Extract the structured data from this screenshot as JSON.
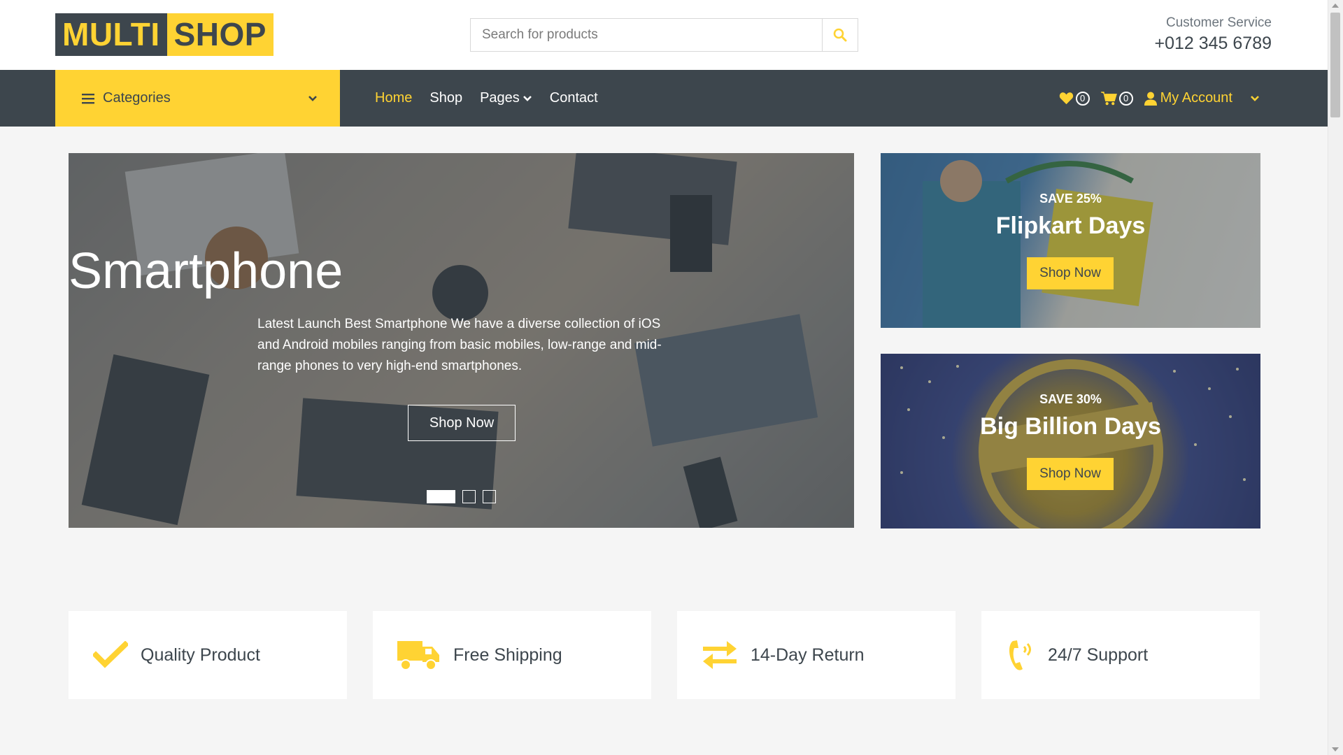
{
  "header": {
    "logo_part1": "MULTI",
    "logo_part2": "SHOP",
    "search_placeholder": "Search for products",
    "customer_service_label": "Customer Service",
    "customer_service_phone": "+012 345 6789"
  },
  "nav": {
    "categories_label": "Categories",
    "menu": [
      {
        "label": "Home",
        "active": true
      },
      {
        "label": "Shop"
      },
      {
        "label": "Pages",
        "has_dropdown": true
      },
      {
        "label": "Contact"
      }
    ],
    "wishlist_count": "0",
    "cart_count": "0",
    "account_label": "My Account"
  },
  "hero": {
    "title": "Smartphone",
    "description": "Latest Launch Best Smartphone We have a diverse collection of iOS and Android mobiles ranging from basic mobiles, low-range and mid-range phones to very high-end smartphones.",
    "button_label": "Shop Now",
    "slides_total": 3,
    "active_slide": 1
  },
  "offers": [
    {
      "save": "SAVE 25%",
      "title": "Flipkart Days",
      "button_label": "Shop Now"
    },
    {
      "save": "SAVE 30%",
      "title": "Big Billion Days",
      "button_label": "Shop Now"
    }
  ],
  "features": [
    {
      "icon": "check-icon",
      "label": "Quality Product"
    },
    {
      "icon": "shipping-icon",
      "label": "Free Shipping"
    },
    {
      "icon": "exchange-icon",
      "label": "14-Day Return"
    },
    {
      "icon": "phone-volume-icon",
      "label": "24/7 Support"
    }
  ],
  "colors": {
    "primary": "#ffd333",
    "dark": "#3d464d",
    "background": "#f5f5f5"
  }
}
